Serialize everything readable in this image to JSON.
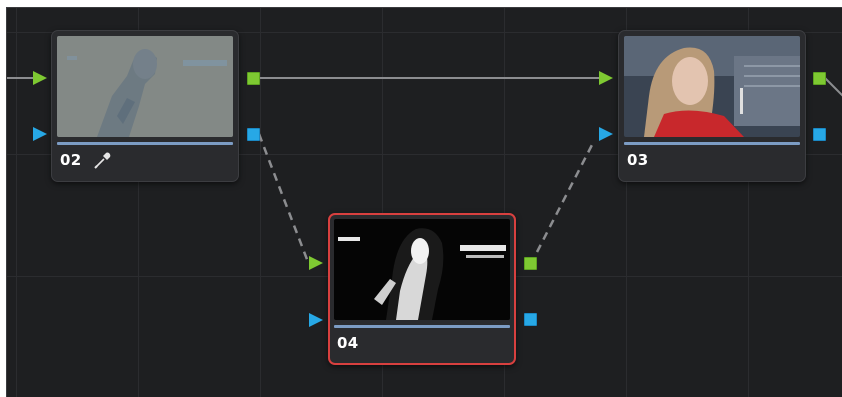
{
  "nodes": [
    {
      "id": "n02",
      "label": "02",
      "selected": false,
      "has_qualifier_icon": true
    },
    {
      "id": "n03",
      "label": "03",
      "selected": false,
      "has_qualifier_icon": false
    },
    {
      "id": "n04",
      "label": "04",
      "selected": true,
      "has_qualifier_icon": false
    }
  ],
  "colors": {
    "canvas_bg": "#1e1f21",
    "grid_line": "#2b2c2f",
    "node_bg": "#2a2b2e",
    "selected_border": "#d8403f",
    "rgb_port": "#7ec932",
    "alpha_port": "#27a8e6",
    "node_bar": "#7c9cc4",
    "link_line": "#8c8d90"
  },
  "icons": {
    "rgb_input": "green-triangle-icon",
    "alpha_input": "blue-triangle-icon",
    "rgb_output": "green-square-icon",
    "alpha_output": "blue-square-icon",
    "qualifier": "eyedropper-icon"
  }
}
